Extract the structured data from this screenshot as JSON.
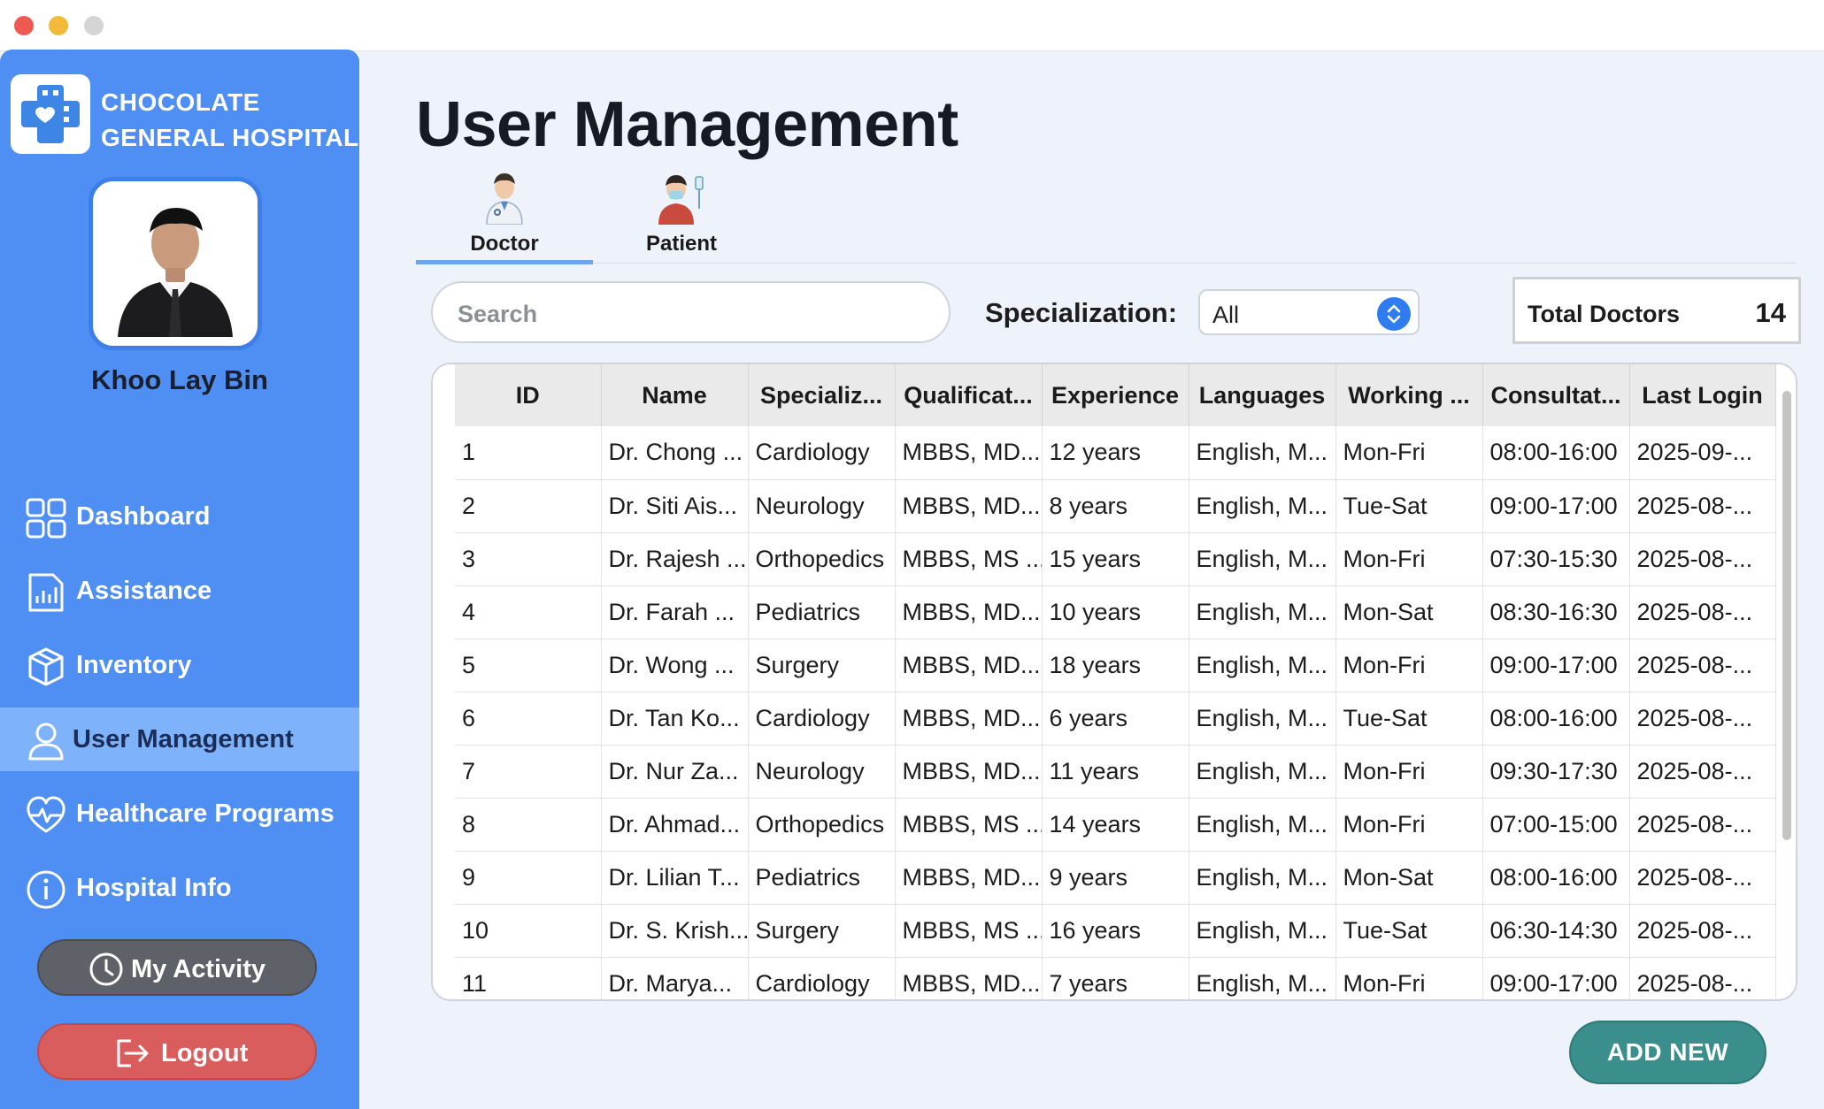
{
  "app": {
    "brand_line1": "CHOCOLATE",
    "brand_line2": "GENERAL HOSPITAL",
    "user_name": "Khoo Lay Bin"
  },
  "sidebar": {
    "items": [
      {
        "label": "Dashboard",
        "icon": "dashboard-grid-icon"
      },
      {
        "label": "Assistance",
        "icon": "report-chart-icon"
      },
      {
        "label": "Inventory",
        "icon": "box-icon"
      },
      {
        "label": "User Management",
        "icon": "user-icon",
        "active": true
      },
      {
        "label": "Healthcare Programs",
        "icon": "heart-pulse-icon"
      },
      {
        "label": "Hospital Info",
        "icon": "info-icon"
      }
    ],
    "activity_label": "My Activity",
    "logout_label": "Logout"
  },
  "main": {
    "title": "User Management",
    "tabs": [
      {
        "label": "Doctor",
        "icon": "doctor-icon",
        "selected": true
      },
      {
        "label": "Patient",
        "icon": "patient-icon",
        "selected": false
      }
    ],
    "search_placeholder": "Search",
    "spec_label": "Specialization:",
    "spec_value": "All",
    "total_label": "Total Doctors",
    "total_value": "14",
    "add_label": "ADD NEW"
  },
  "table": {
    "columns": [
      "ID",
      "Name",
      "Specializ...",
      "Qualificat...",
      "Experience",
      "Languages",
      "Working ...",
      "Consultat...",
      "Last Login"
    ],
    "rows": [
      [
        "1",
        "Dr. Chong ...",
        "Cardiology",
        "MBBS, MD...",
        "12 years",
        "English, M...",
        "Mon-Fri",
        "08:00-16:00",
        "2025-09-..."
      ],
      [
        "2",
        "Dr. Siti Ais...",
        "Neurology",
        "MBBS, MD...",
        "8 years",
        "English, M...",
        "Tue-Sat",
        "09:00-17:00",
        "2025-08-..."
      ],
      [
        "3",
        "Dr. Rajesh ...",
        "Orthopedics",
        "MBBS, MS ...",
        "15 years",
        "English, M...",
        "Mon-Fri",
        "07:30-15:30",
        "2025-08-..."
      ],
      [
        "4",
        "Dr. Farah ...",
        "Pediatrics",
        "MBBS, MD...",
        "10 years",
        "English, M...",
        "Mon-Sat",
        "08:30-16:30",
        "2025-08-..."
      ],
      [
        "5",
        "Dr. Wong ...",
        "Surgery",
        "MBBS, MD...",
        "18 years",
        "English, M...",
        "Mon-Fri",
        "09:00-17:00",
        "2025-08-..."
      ],
      [
        "6",
        "Dr. Tan Ko...",
        "Cardiology",
        "MBBS, MD...",
        "6 years",
        "English, M...",
        "Tue-Sat",
        "08:00-16:00",
        "2025-08-..."
      ],
      [
        "7",
        "Dr. Nur Za...",
        "Neurology",
        "MBBS, MD...",
        "11 years",
        "English, M...",
        "Mon-Fri",
        "09:30-17:30",
        "2025-08-..."
      ],
      [
        "8",
        "Dr. Ahmad...",
        "Orthopedics",
        "MBBS, MS ...",
        "14 years",
        "English, M...",
        "Mon-Fri",
        "07:00-15:00",
        "2025-08-..."
      ],
      [
        "9",
        "Dr. Lilian T...",
        "Pediatrics",
        "MBBS, MD...",
        "9 years",
        "English, M...",
        "Mon-Sat",
        "08:00-16:00",
        "2025-08-..."
      ],
      [
        "10",
        "Dr. S. Krish...",
        "Surgery",
        "MBBS, MS ...",
        "16 years",
        "English, M...",
        "Tue-Sat",
        "06:30-14:30",
        "2025-08-..."
      ],
      [
        "11",
        "Dr. Marya...",
        "Cardiology",
        "MBBS, MD...",
        "7 years",
        "English, M...",
        "Mon-Fri",
        "09:00-17:00",
        "2025-08-..."
      ]
    ]
  },
  "colors": {
    "sidebar": "#4f8ef2",
    "sidebar_active": "#7eb3fb",
    "logout": "#d95d5d",
    "activity": "#5e6167",
    "add_new": "#3a8f8d",
    "tab_underline": "#6aa6ee"
  }
}
